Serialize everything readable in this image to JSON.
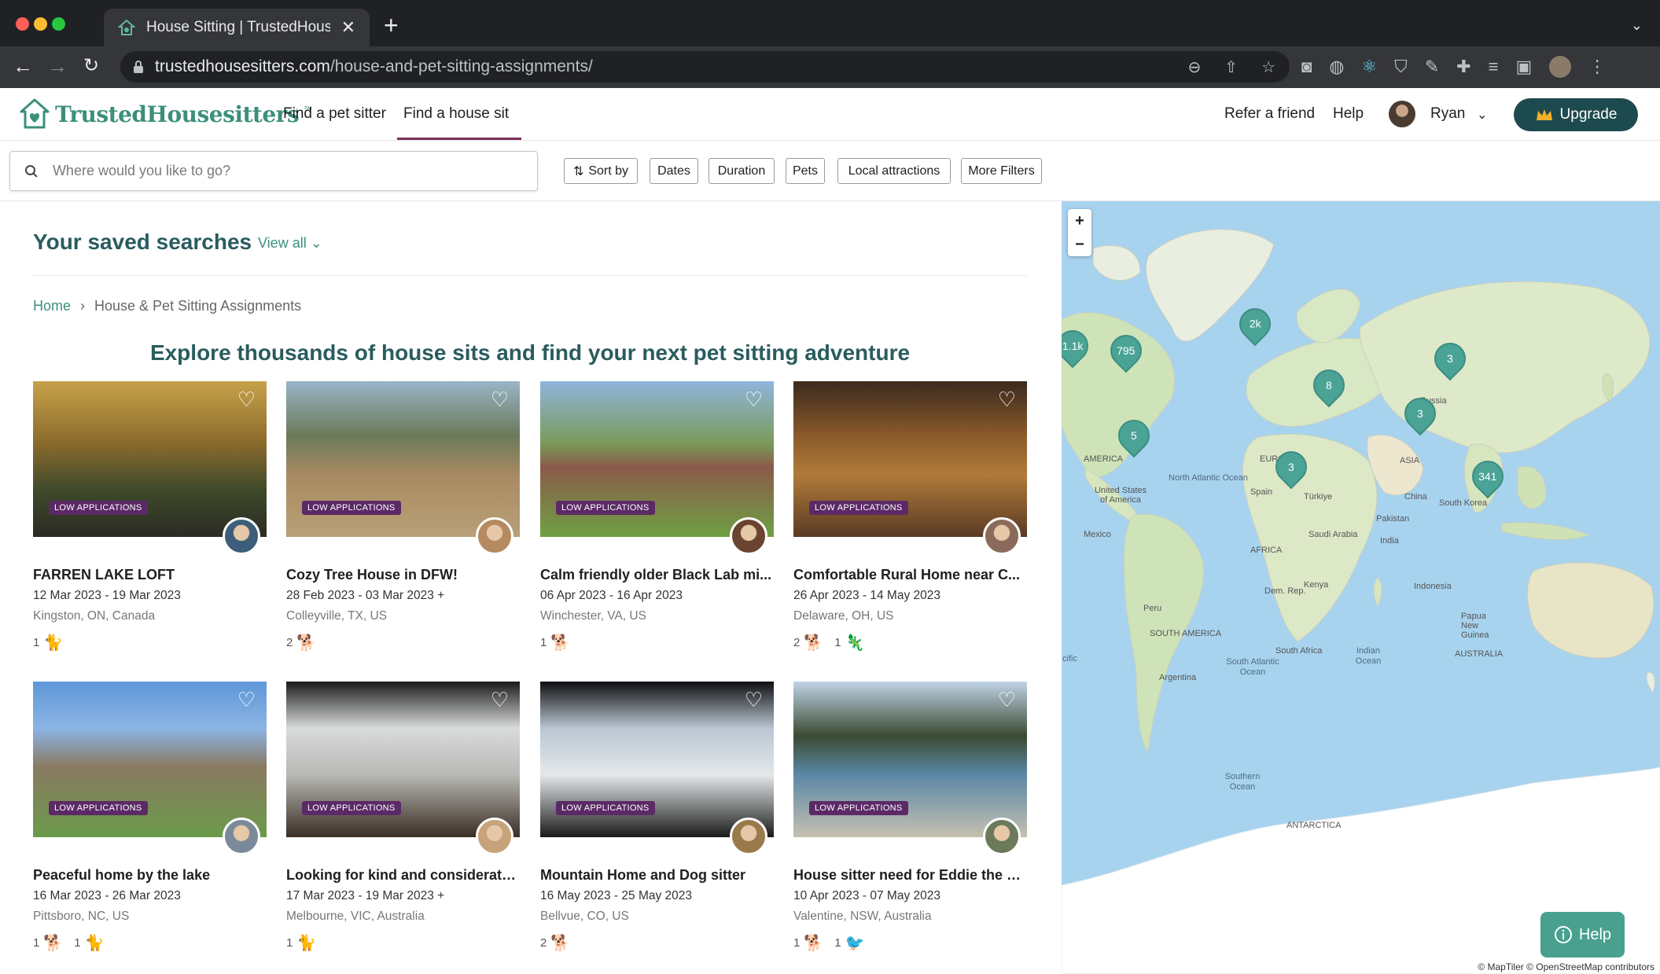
{
  "browser": {
    "tab_title": "House Sitting | TrustedHousesi",
    "url_host": "trustedhousesitters.com",
    "url_path": "/house-and-pet-sitting-assignments/"
  },
  "header": {
    "logo": "TrustedHousesitters",
    "logo_tm": "™",
    "nav": [
      "Find a pet sitter",
      "Find a house sit"
    ],
    "active_nav": "Find a house sit",
    "refer": "Refer a friend",
    "help": "Help",
    "user": "Ryan",
    "upgrade": "Upgrade"
  },
  "filters": {
    "search_placeholder": "Where would you like to go?",
    "sort": "Sort by",
    "dates": "Dates",
    "duration": "Duration",
    "pets": "Pets",
    "local": "Local attractions",
    "more": "More Filters"
  },
  "saved": {
    "title": "Your saved searches",
    "view_all": "View all"
  },
  "breadcrumb": {
    "home": "Home",
    "current": "House & Pet Sitting Assignments"
  },
  "headline": "Explore thousands of house sits and find your next pet sitting adventure",
  "badge": "LOW APPLICATIONS",
  "listings": [
    {
      "title": "FARREN LAKE LOFT",
      "dates": "12 Mar 2023 - 19 Mar 2023",
      "location": "Kingston, ON, Canada",
      "pets": [
        {
          "count": "1",
          "icon": "cat-icon"
        }
      ]
    },
    {
      "title": "Cozy Tree House in DFW!",
      "dates": "28 Feb 2023 - 03 Mar 2023 +",
      "location": "Colleyville, TX, US",
      "pets": [
        {
          "count": "2",
          "icon": "dog-icon"
        }
      ]
    },
    {
      "title": "Calm friendly older Black Lab mi...",
      "dates": "06 Apr 2023 - 16 Apr 2023",
      "location": "Winchester, VA, US",
      "pets": [
        {
          "count": "1",
          "icon": "dog-icon"
        }
      ]
    },
    {
      "title": "Comfortable Rural Home near C...",
      "dates": "26 Apr 2023 - 14 May 2023",
      "location": "Delaware, OH, US",
      "pets": [
        {
          "count": "2",
          "icon": "dog-icon"
        },
        {
          "count": "1",
          "icon": "reptile-icon"
        }
      ]
    },
    {
      "title": "Peaceful home by the lake",
      "dates": "16 Mar 2023 - 26 Mar 2023",
      "location": "Pittsboro, NC, US",
      "pets": [
        {
          "count": "1",
          "icon": "dog-icon"
        },
        {
          "count": "1",
          "icon": "cat-icon"
        }
      ]
    },
    {
      "title": "Looking for kind and considerate...",
      "dates": "17 Mar 2023 - 19 Mar 2023 +",
      "location": "Melbourne, VIC, Australia",
      "pets": [
        {
          "count": "1",
          "icon": "cat-icon"
        }
      ]
    },
    {
      "title": "Mountain Home and Dog sitter",
      "dates": "16 May 2023 - 25 May 2023",
      "location": "Bellvue, CO, US",
      "pets": [
        {
          "count": "2",
          "icon": "dog-icon"
        }
      ]
    },
    {
      "title": "House sitter need for Eddie the sc...",
      "dates": "10 Apr 2023 - 07 May 2023",
      "location": "Valentine, NSW, Australia",
      "pets": [
        {
          "count": "1",
          "icon": "dog-icon"
        },
        {
          "count": "1",
          "icon": "bird-icon"
        }
      ]
    }
  ],
  "map": {
    "clusters": [
      "1.1k",
      "795",
      "2k",
      "5",
      "8",
      "3",
      "3",
      "3",
      "341"
    ],
    "labels": {
      "north_atlantic": "North Atlantic Ocean",
      "south_atlantic": "South Atlantic Ocean",
      "indian": "Indian Ocean",
      "southern": "Southern Ocean",
      "america": "AMERICA",
      "usa": "United States of America",
      "mexico": "Mexico",
      "south_america": "SOUTH AMERICA",
      "peru": "Peru",
      "argentina": "Argentina",
      "europe": "EUROPE",
      "spain": "Spain",
      "africa": "AFRICA",
      "asia": "ASIA",
      "russia": "Russia",
      "china": "China",
      "india": "India",
      "pakistan": "Pakistan",
      "turkey": "Türkiye",
      "saudi": "Saudi Arabia",
      "south_korea": "South Korea",
      "indonesia": "Indonesia",
      "australia": "AUSTRALIA",
      "papua": "Papua New Guinea",
      "south_africa": "South Africa",
      "kenya": "Kenya",
      "drc": "Dem. Rep.",
      "antarctica": "ANTARCTICA",
      "pacific": "cific"
    },
    "attribution": "© MapTiler © OpenStreetMap contributors"
  },
  "help_button": "Help"
}
